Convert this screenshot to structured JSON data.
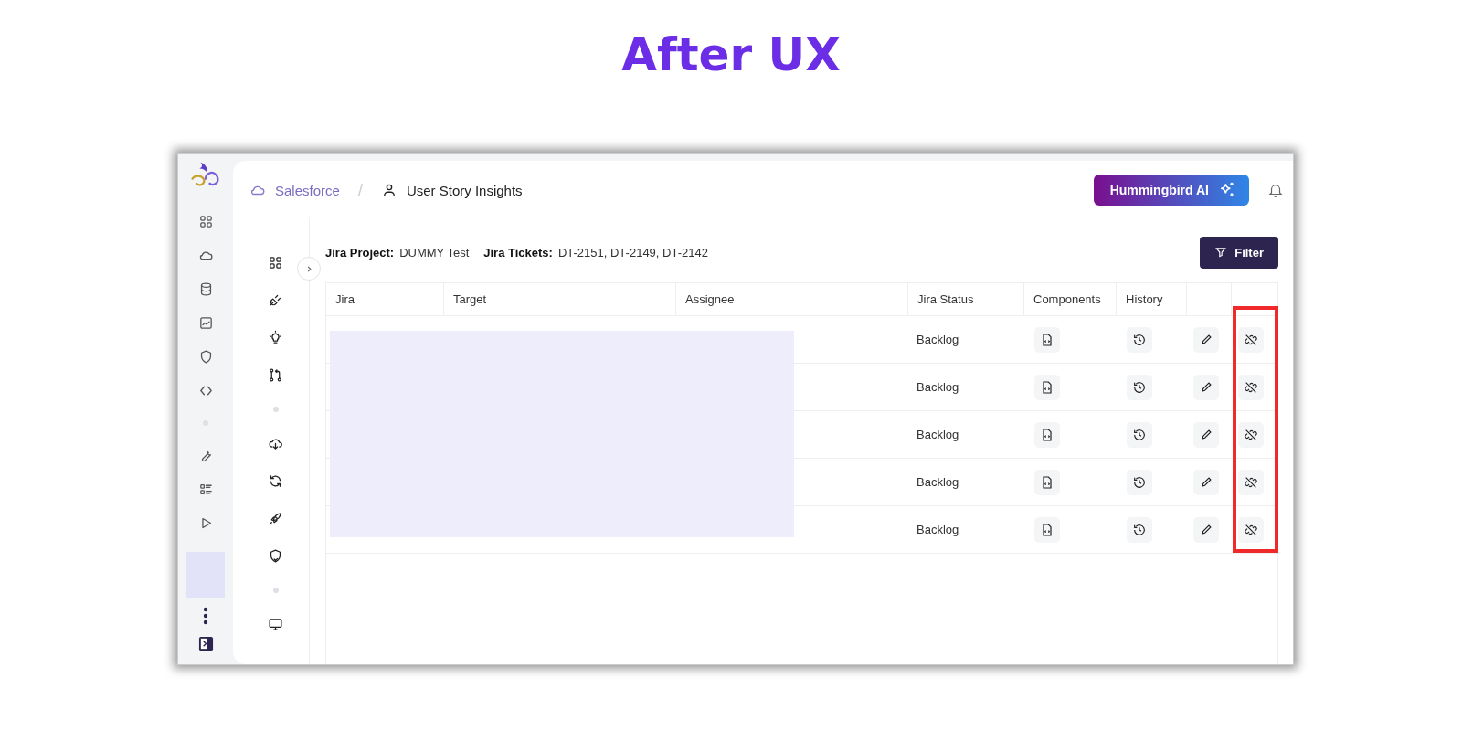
{
  "heading": "After UX",
  "breadcrumb": {
    "org": "Salesforce",
    "separator": "/",
    "page": "User Story Insights"
  },
  "ai_button": "Hummingbird AI",
  "info": [
    {
      "label": "Jira Project:",
      "value": "DUMMY Test"
    },
    {
      "label": "Jira Tickets:",
      "value": "DT-2151, DT-2149, DT-2142"
    }
  ],
  "filter_button": "Filter",
  "table": {
    "columns": [
      "Jira",
      "Target",
      "Assignee",
      "Jira Status",
      "Components",
      "History"
    ],
    "rows": [
      {
        "jira_status": "Backlog"
      },
      {
        "jira_status": "Backlog"
      },
      {
        "jira_status": "Backlog"
      },
      {
        "jira_status": "Backlog"
      },
      {
        "jira_status": "Backlog"
      }
    ]
  }
}
